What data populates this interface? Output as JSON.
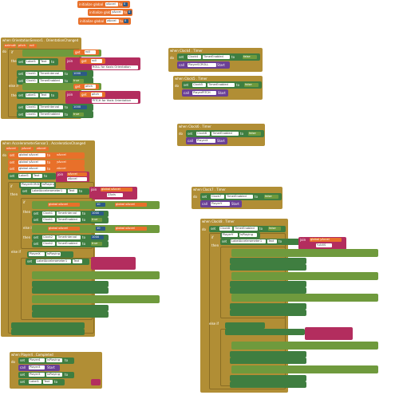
{
  "globals": [
    {
      "kw": "initialize global",
      "name": "xAccel",
      "to": "to",
      "val": "0"
    },
    {
      "kw": "initialize global",
      "name": "yAccel",
      "to": "to",
      "val": "0"
    },
    {
      "kw": "initialize global",
      "name": "zAccel",
      "to": "to",
      "val": "0"
    }
  ],
  "orientation": {
    "header": "when OrientationSensor1 . OrientationChanged",
    "params": [
      "azimuth",
      "pitch",
      "roll"
    ],
    "do": "do",
    "if": "if",
    "then": "then",
    "elseif": "else if",
    "label": "Label1",
    "text_prop": "Text",
    "to": "to",
    "join": "join",
    "roll_text": "ROLL for Xaxis Orientation",
    "pitch_text": "PITCH for Yaxis Orientation",
    "clock": "Clock1",
    "timer_interval": "TimerInterval",
    "timer_enabled": "TimerEnabled",
    "interval_val": "1000",
    "true": "true",
    "get": "get",
    "roll": "roll",
    "pitch": "pitch"
  },
  "accel": {
    "header": "when AccelerometerSensor1 . AccelerationChanged",
    "params": [
      "xAccel",
      "yAccel",
      "zAccel"
    ],
    "do": "do",
    "set": "set",
    "to": "to",
    "g_x": "global xAccel",
    "g_y": "global yAccel",
    "g_z": "global zAccel",
    "get": "get",
    "label": "Label1",
    "text_prop": "Text",
    "join": "join",
    "xaccel": "xAccel",
    "zaccel": "ZAxis",
    "if": "if",
    "then": "then",
    "elseif": "else if",
    "player_scroll": "PlayerSCROLL",
    "is_playing": "IsPlaying",
    "label_accel": "LabelAccelerometer1",
    "clock": "Clock1",
    "clock2": "Clock2",
    "timer_interval": "TimerInterval",
    "timer_enabled": "TimerEnabled",
    "val1000": "1000",
    "val10": "10",
    "true": "true",
    "false": "false",
    "player_x": "PlayerX",
    "is_playing2": "IsPlaying"
  },
  "clock4_top": {
    "header": "when Clock4 . Timer",
    "do": "do",
    "set": "set",
    "clock": "Clock4",
    "timer_enabled": "TimerEnabled",
    "to": "to",
    "false": "false",
    "call": "call",
    "player": "PlayerSCROLL",
    "start": "Start"
  },
  "clock5": {
    "header": "when Clock5 . Timer",
    "do": "do",
    "set": "set",
    "clock": "Clock5",
    "timer_enabled": "TimerEnabled",
    "to": "to",
    "false": "false",
    "call": "call",
    "player": "PlayerPITCH",
    "start": "Start"
  },
  "clock6": {
    "header": "when Clock6 . Timer",
    "do": "do",
    "set": "set",
    "clock": "Clock6",
    "timer_enabled": "TimerEnabled",
    "to": "to",
    "false": "false",
    "call": "call",
    "player": "PlayerX",
    "start": "Start"
  },
  "clock7": {
    "header": "when Clock7 . Timer",
    "do": "do",
    "set": "set",
    "clock": "Clock7",
    "timer_enabled": "TimerEnabled",
    "to": "to",
    "false": "false",
    "call": "call",
    "player": "PlayerY",
    "start": "Start"
  },
  "clock8": {
    "header": "when Clock8 . Timer",
    "do": "do",
    "set": "set",
    "clock": "Clock8",
    "timer_enabled": "TimerEnabled",
    "to": "to",
    "false": "false",
    "label": "LabelAccelerometer1",
    "text_prop": "Text",
    "join": "join",
    "get": "get",
    "g_x": "global xAccel",
    "g_y": "global yAccel",
    "xaxis": "X-AXIS",
    "yaxis": "Y-AXIS",
    "if": "if",
    "then": "then",
    "elseif": "else if",
    "timer_interval": "TimerInterval",
    "val1000": "1000",
    "true": "true",
    "player": "PlayerY",
    "is_playing": "IsPlaying"
  },
  "player4": {
    "header": "when Player4 . Completed",
    "do": "do",
    "set": "set",
    "player": "Player4",
    "is_playing": "IsPlaying",
    "to": "to",
    "call": "call",
    "player2": "Player3",
    "start": "Start",
    "player3": "Player3",
    "label": "Label1",
    "text_prop": "Text",
    "false": "false"
  }
}
